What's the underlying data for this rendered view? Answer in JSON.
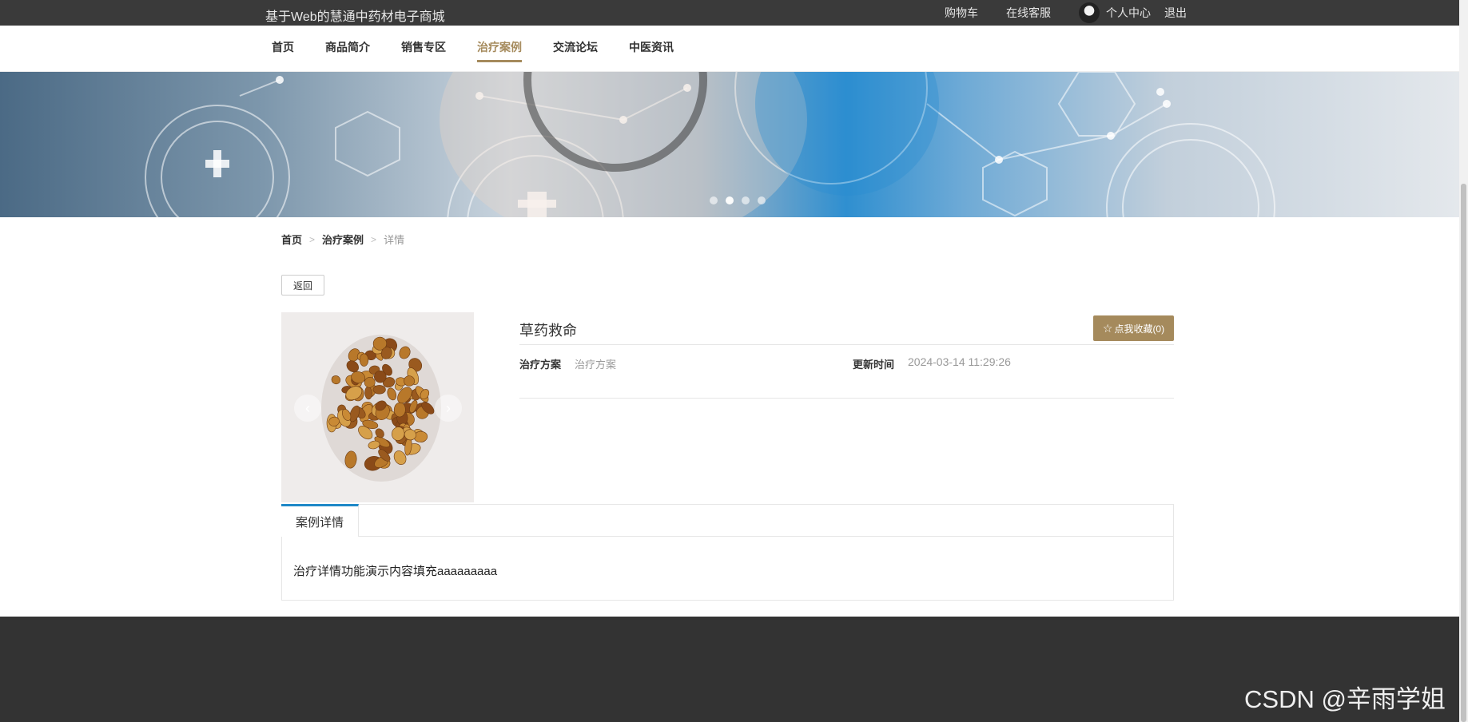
{
  "topbar": {
    "site_title": "基于Web的慧通中药材电子商城",
    "cart": "购物车",
    "service": "在线客服",
    "user_center": "个人中心",
    "logout": "退出"
  },
  "nav": {
    "items": [
      "首页",
      "商品简介",
      "销售专区",
      "治疗案例",
      "交流论坛",
      "中医资讯"
    ],
    "active": "治疗案例"
  },
  "breadcrumb": {
    "home": "首页",
    "section": "治疗案例",
    "separator": ">",
    "current": "详情"
  },
  "back_button": "返回",
  "detail": {
    "title": "草药救命",
    "favorite_label": "点我收藏(0)",
    "plan_label": "治疗方案",
    "plan_value": "治疗方案",
    "updated_label": "更新时间",
    "updated_value": "2024-03-14 11:29:26",
    "gallery_prev": "‹",
    "gallery_next": "›"
  },
  "tabs": {
    "case_detail": "案例详情",
    "content": "治疗详情功能演示内容填充aaaaaaaaa"
  },
  "watermark": "CSDN @辛雨学姐",
  "colors": {
    "accent": "#a58a5c",
    "topbar": "#3a3a3a",
    "tab_accent": "#1e88c7",
    "footer": "#333333"
  }
}
